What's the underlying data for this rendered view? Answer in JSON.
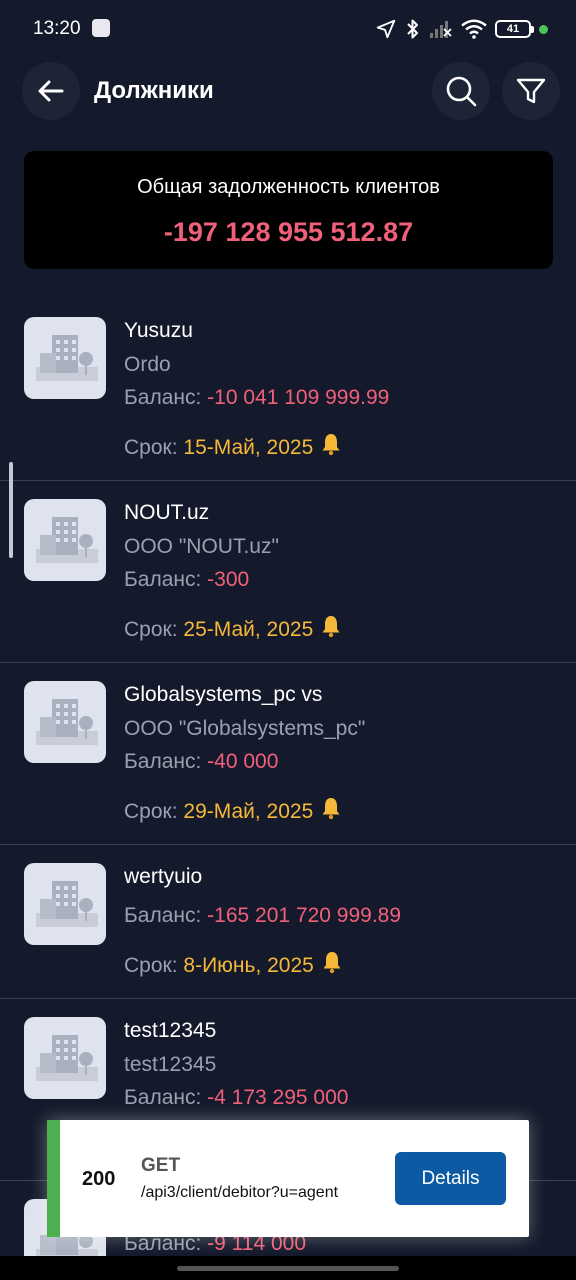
{
  "status_bar": {
    "time": "13:20",
    "battery": "41",
    "icons": [
      "square-icon",
      "location-arrow-icon",
      "bluetooth-icon",
      "signal-off-icon",
      "wifi-icon",
      "battery-icon",
      "charging-dot-icon"
    ]
  },
  "app_bar": {
    "title": "Должники",
    "back_icon": "arrow-left-icon",
    "search_icon": "search-icon",
    "filter_icon": "funnel-icon"
  },
  "summary": {
    "label": "Общая задолженность клиентов",
    "value": "-197 128 955 512.87"
  },
  "debtors": [
    {
      "name": "Yusuzu",
      "company": "Ordo",
      "balance_label": "Баланс: ",
      "balance": "-10 041 109 999.99",
      "due_label": "Срок: ",
      "due": "15-Май, 2025"
    },
    {
      "name": "NOUT.uz",
      "company": "ООО \"NOUT.uz\"",
      "balance_label": "Баланс: ",
      "balance": "-300",
      "due_label": "Срок: ",
      "due": "25-Май, 2025"
    },
    {
      "name": "Globalsystems_pc vs",
      "company": "ООО \"Globalsystems_pc\"",
      "balance_label": "Баланс: ",
      "balance": "-40 000",
      "due_label": "Срок: ",
      "due": "29-Май, 2025"
    },
    {
      "name": "wertyuio",
      "balance_label": "Баланс: ",
      "balance": "-165 201 720 999.89",
      "due_label": "Срок: ",
      "due": "8-Июнь, 2025"
    },
    {
      "name": "test12345",
      "company": "test12345",
      "balance_label": "Баланс: ",
      "balance": "-4 173 295 000"
    },
    {
      "balance_label": "Баланс: ",
      "balance": "-9 114 000"
    }
  ],
  "toast": {
    "status_code": "200",
    "method": "GET",
    "path": "/api3/client/debitor?u=agent",
    "button_label": "Details",
    "accent_color": "#4caf50"
  },
  "colors": {
    "background": "#141a2b",
    "negative": "#f0607a",
    "due_date": "#f5b838",
    "button": "#0b5aa3"
  }
}
